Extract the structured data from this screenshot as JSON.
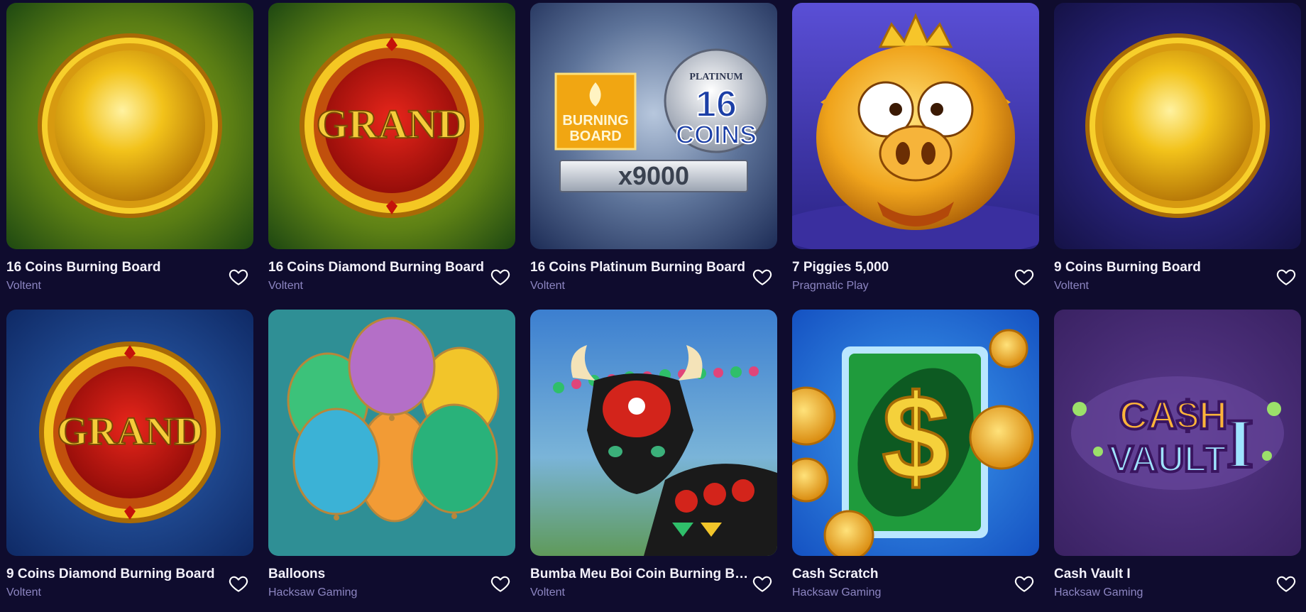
{
  "games": [
    {
      "title": "16 Coins Burning Board",
      "provider": "Voltent",
      "icon": "heart-outline-icon"
    },
    {
      "title": "16 Coins Diamond Burning Board",
      "provider": "Voltent",
      "icon": "heart-outline-icon"
    },
    {
      "title": "16 Coins Platinum Burning Board",
      "provider": "Voltent",
      "icon": "heart-outline-icon",
      "art": {
        "logo1_line1": "BURNING",
        "logo1_line2": "BOARD",
        "logo2_top": "PLATINUM",
        "logo2_num": "16",
        "logo2_word": "COINS",
        "multiplier": "x9000"
      }
    },
    {
      "title": "7 Piggies 5,000",
      "provider": "Pragmatic Play",
      "icon": "heart-outline-icon"
    },
    {
      "title": "9 Coins Burning Board",
      "provider": "Voltent",
      "icon": "heart-outline-icon"
    },
    {
      "title": "9 Coins Diamond Burning Board",
      "provider": "Voltent",
      "icon": "heart-outline-icon",
      "art": {
        "word": "GRAND"
      }
    },
    {
      "title": "Balloons",
      "provider": "Hacksaw Gaming",
      "icon": "heart-outline-icon"
    },
    {
      "title": "Bumba Meu Boi Coin Burning Bo...",
      "provider": "Voltent",
      "icon": "heart-outline-icon"
    },
    {
      "title": "Cash Scratch",
      "provider": "Hacksaw Gaming",
      "icon": "heart-outline-icon"
    },
    {
      "title": "Cash Vault I",
      "provider": "Hacksaw Gaming",
      "icon": "heart-outline-icon",
      "art": {
        "line1": "CA$H",
        "line2": "VAULT",
        "numeral": "I"
      }
    }
  ],
  "grand_word": "GRAND",
  "colors": {
    "background": "#0f0c2e",
    "title": "#f3f1fb",
    "provider": "#8d86c2"
  }
}
